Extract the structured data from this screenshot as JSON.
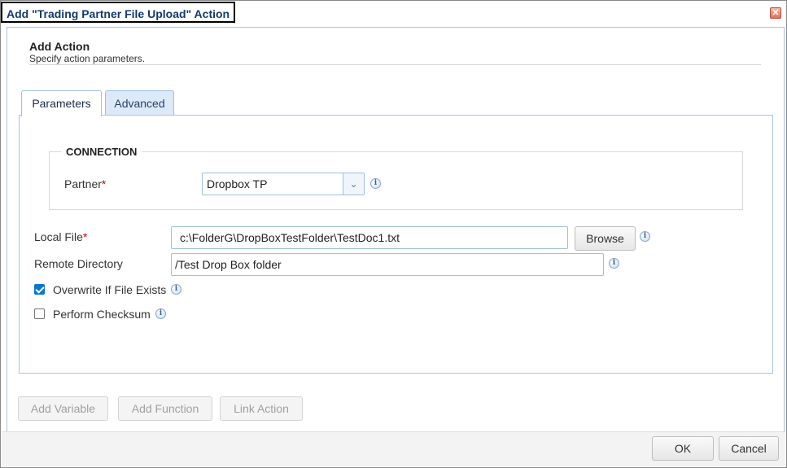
{
  "window": {
    "title": "Add \"Trading Partner File Upload\" Action",
    "close_icon": "close-icon"
  },
  "header": {
    "title": "Add Action",
    "subtitle": "Specify action parameters."
  },
  "tabs": [
    {
      "label": "Parameters",
      "active": true
    },
    {
      "label": "Advanced",
      "active": false
    }
  ],
  "connection": {
    "legend": "CONNECTION",
    "partner_label": "Partner",
    "partner_required": "*",
    "partner_value": "Dropbox TP"
  },
  "fields": {
    "local_file_label": "Local File",
    "local_file_required": "*",
    "local_file_value": "c:\\FolderG\\DropBoxTestFolder\\TestDoc1.txt",
    "browse_label": "Browse",
    "remote_dir_label": "Remote Directory",
    "remote_dir_value": "/Test Drop Box folder",
    "overwrite_label": "Overwrite If File Exists",
    "overwrite_checked": true,
    "checksum_label": "Perform Checksum",
    "checksum_checked": false
  },
  "actions": {
    "add_variable": "Add Variable",
    "add_function": "Add Function",
    "link_action": "Link Action"
  },
  "footer": {
    "ok": "OK",
    "cancel": "Cancel"
  },
  "colors": {
    "title_text": "#15396b",
    "tab_border": "#9cc0e6",
    "checkbox_checked": "#0b74d1",
    "required": "#cc0000"
  }
}
